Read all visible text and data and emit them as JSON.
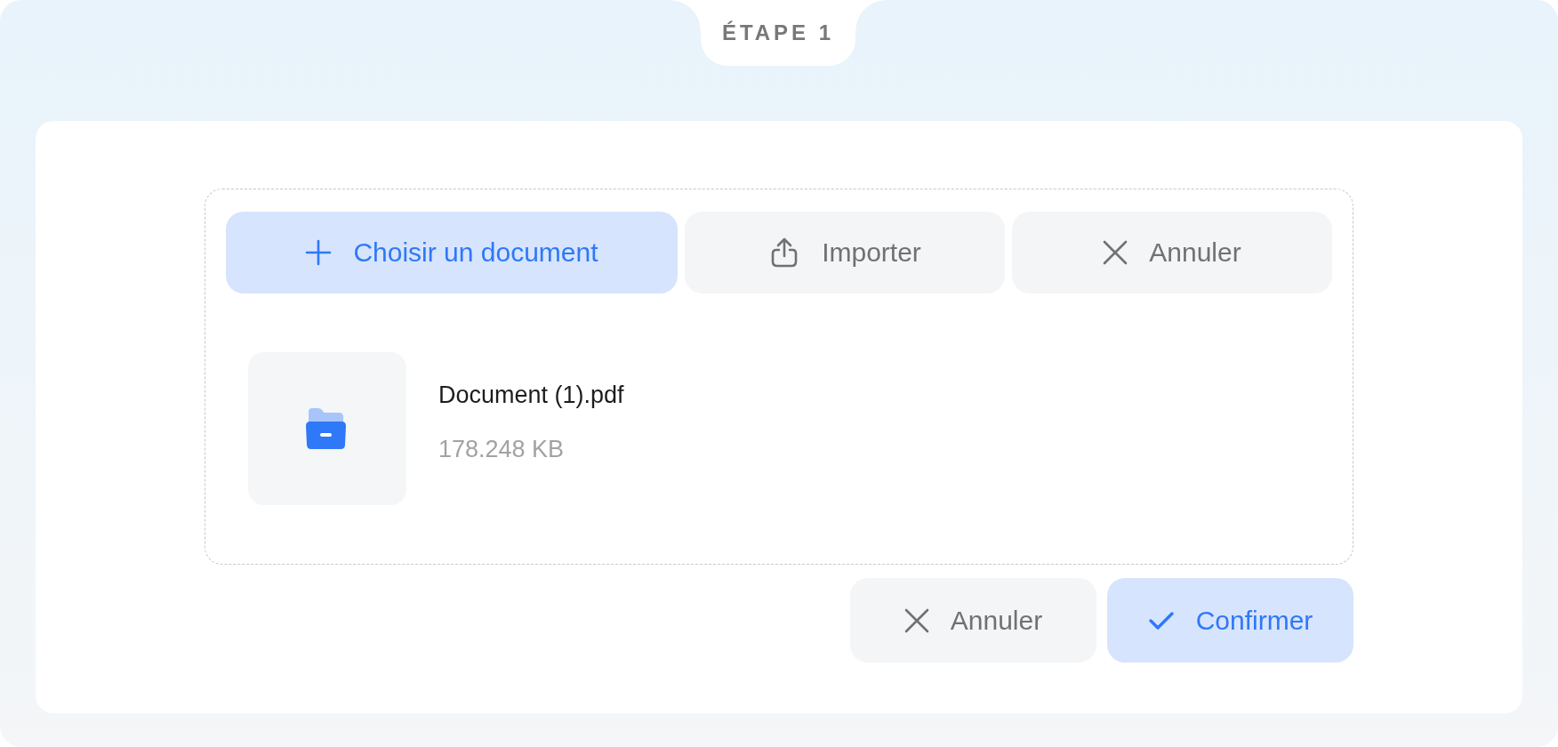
{
  "step": {
    "label": "ÉTAPE 1"
  },
  "toolbar": [
    {
      "kind": "add",
      "label": "Choisir un document"
    },
    {
      "kind": "upload",
      "label": "Importer"
    },
    {
      "kind": "cancel",
      "label": "Annuler"
    }
  ],
  "file": {
    "name": "Document (1).pdf",
    "size": "178.248 KB"
  },
  "actions": [
    {
      "kind": "cancel",
      "label": "Annuler"
    },
    {
      "kind": "confirm",
      "label": "Confirmer"
    }
  ]
}
